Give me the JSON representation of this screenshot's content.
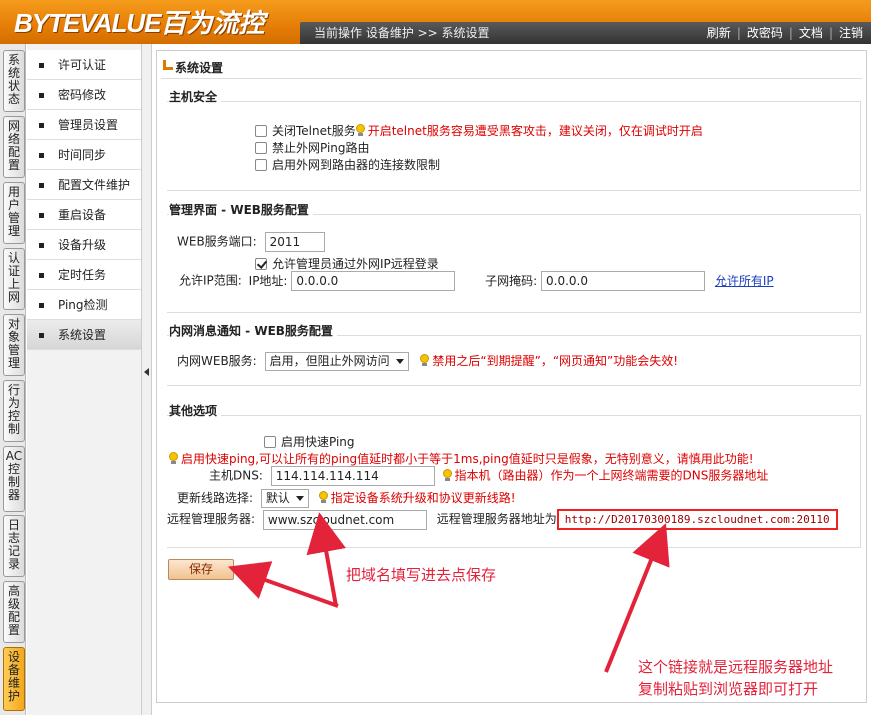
{
  "brand": {
    "logo_text": "BYTEVALUE",
    "logo_cn": "百为流控"
  },
  "topbar": {
    "breadcrumb": "当前操作  设备维护 >> 系统设置",
    "links": [
      "刷新",
      "改密码",
      "文档",
      "注销"
    ]
  },
  "vtabs": [
    "系统状态",
    "网络配置",
    "用户管理",
    "认证上网",
    "对象管理",
    "行为控制",
    "AC控制器",
    "日志记录",
    "高级配置",
    "设备维护"
  ],
  "submenu": [
    "许可认证",
    "密码修改",
    "管理员设置",
    "时间同步",
    "配置文件维护",
    "重启设备",
    "设备升级",
    "定时任务",
    "Ping检测",
    "系统设置"
  ],
  "page": {
    "title": "系统设置"
  },
  "host_security": {
    "title": "主机安全",
    "telnet_label": "关闭Telnet服务",
    "telnet_warning": "开启telnet服务容易遭受黑客攻击，建议关闭，仅在调试时开启",
    "ping_label": "禁止外网Ping路由",
    "connlimit_label": "启用外网到路由器的连接数限制"
  },
  "web_admin": {
    "title": "管理界面 - WEB服务配置",
    "port_label": "WEB服务端口:",
    "port_value": "2011",
    "remote_login_label": "允许管理员通过外网IP远程登录",
    "ip_range_label": "允许IP范围:",
    "ip_label": "IP地址:",
    "ip_value": "0.0.0.0",
    "mask_label": "子网掩码:",
    "mask_value": "0.0.0.0",
    "allow_all_link": "允许所有IP"
  },
  "intranet_notify": {
    "title": "内网消息通知 - WEB服务配置",
    "service_label": "内网WEB服务:",
    "service_value": "启用，但阻止外网访问",
    "warning": "禁用之后“到期提醒”，“网页通知”功能会失效!"
  },
  "other": {
    "title": "其他选项",
    "fastping_label": "启用快速Ping",
    "fastping_warning": "启用快速ping,可以让所有的ping值延时都小于等于1ms,ping值延时只是假象，无特别意义，请慎用此功能!",
    "dns_label": "主机DNS:",
    "dns_value": "114.114.114.114",
    "dns_hint": "指本机（路由器）作为一个上网终端需要的DNS服务器地址",
    "route_label": "更新线路选择:",
    "route_value": "默认",
    "route_hint": "指定设备系统升级和协议更新线路!",
    "remote_server_label": "远程管理服务器:",
    "remote_server_value": "www.szcloudnet.com",
    "remote_addr_label": "远程管理服务器地址为",
    "remote_addr_value": "http://D20170300189.szcloudnet.com:20110"
  },
  "save_label": "保存",
  "annotations": {
    "fill_hint": "把域名填写进去点保存",
    "link_hint_1": "这个链接就是远程服务器地址",
    "link_hint_2": "复制粘贴到浏览器即可打开"
  },
  "colors": {
    "header_orange": "#e57d06",
    "warning_red": "#dd0000",
    "annotation_red": "#e2233a",
    "active_tab": "#f2a81c"
  }
}
